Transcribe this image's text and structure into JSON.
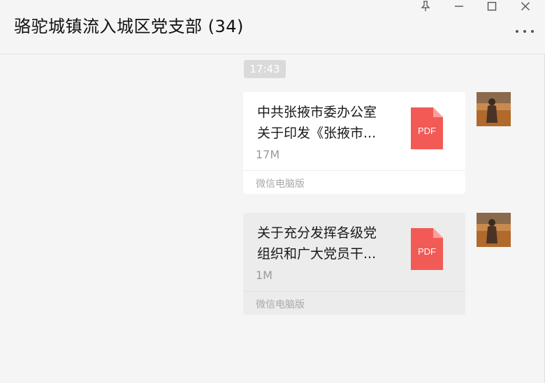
{
  "window": {
    "title": "骆驼城镇流入城区党支部 (34)",
    "controls": [
      "pin-icon",
      "minimize-icon",
      "maximize-icon",
      "close-icon"
    ],
    "more_icon": "more-icon"
  },
  "chat": {
    "timestamp": "17:43",
    "messages": [
      {
        "file_name": "中共张掖市委办公室\n关于印发《张掖市...",
        "file_type": "PDF",
        "file_size": "17M",
        "source": "微信电脑版",
        "selected": false
      },
      {
        "file_name": "关于充分发挥各级党\n组织和广大党员干...",
        "file_type": "PDF",
        "file_size": "1M",
        "source": "微信电脑版",
        "selected": true
      }
    ]
  },
  "colors": {
    "pdf_red": "#f25a56",
    "card_bg": "#ffffff",
    "card_selected_bg": "#ececec",
    "window_bg": "#f5f5f5"
  }
}
